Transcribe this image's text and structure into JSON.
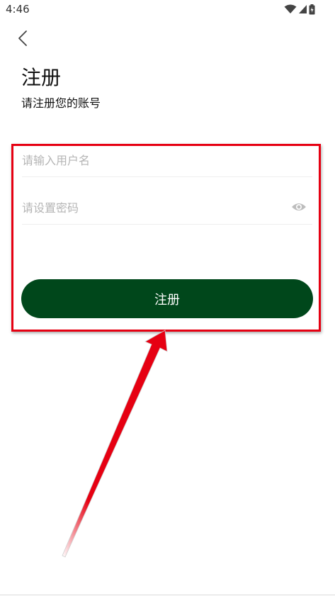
{
  "status_bar": {
    "time": "4:46",
    "icons": [
      "wifi-icon",
      "signal-icon",
      "battery-icon"
    ]
  },
  "header": {
    "back_icon": "chevron-left-icon"
  },
  "title": "注册",
  "subtitle": "请注册您的账号",
  "form": {
    "username": {
      "placeholder": "请输入用户名",
      "value": ""
    },
    "password": {
      "placeholder": "请设置密码",
      "value": "",
      "toggle_icon": "eye-icon"
    },
    "submit_label": "注册"
  },
  "colors": {
    "primary": "#00471b",
    "annotation": "#e60012",
    "placeholder": "#b5b5b5"
  }
}
